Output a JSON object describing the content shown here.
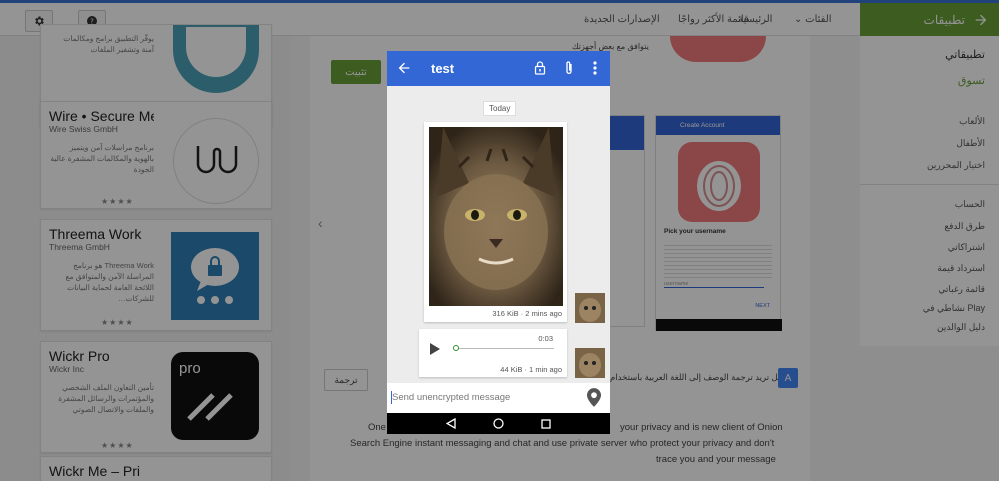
{
  "store": {
    "apps_title": "تطبيقات",
    "nav": [
      "الرئيسية",
      "قائمة الأكثر رواجًا",
      "الإصدارات الجديدة",
      "الفئات"
    ],
    "sidebar_top": [
      "تطبيقاتي",
      "تسوق"
    ],
    "sidebar_groups": [
      "الألعاب",
      "الأطفال",
      "اختيار المحررين"
    ],
    "sidebar_account": [
      "الحساب",
      "طرق الدفع",
      "اشتراكاتي",
      "استرداد قيمة",
      "قائمة رغباتي",
      "نشاطي في Play",
      "دليل الوالدين"
    ],
    "install_label": "تثبيت",
    "translate_label": "ترجمة",
    "translate_prompt": "هل تريد ترجمة الوصف إلى اللغة العربية باستخدام",
    "badge_line": "يتوافق مع بعض أجهزتك",
    "description_lines": [
      "your privacy and is new client of Onion",
      "Search Engine instant messaging and chat and use private server who protect your privacy and don't",
      "trace you and your message"
    ],
    "description_prefix": "One"
  },
  "app_cards": [
    {
      "title": "",
      "developer": "",
      "desc": "يوفّر التطبيق برامج ومكالمات آمنة وتشفير الملفات",
      "rating": "★★★★"
    },
    {
      "title": "Wire • Secure Me",
      "developer": "Wire Swiss GmbH",
      "desc": "برنامج مراسلات آمن ويتميز بالهوية والمكالمات المشفرة عالية الجودة",
      "rating": "★★★★"
    },
    {
      "title": "Threema Work",
      "developer": "Threema GmbH",
      "desc": "Threema Work هو برنامج المراسلة الآمن والمتوافق مع اللائحة العامة لحماية البيانات للشركات…",
      "rating": "★★★★"
    },
    {
      "title": "Wickr Pro",
      "developer": "Wickr Inc",
      "desc": "تأمين التعاون الملف الشخصي والمؤتمرات والرسائل المشفرة والملفات والاتصال الصوتي",
      "rating": "★★★★"
    },
    {
      "title": "Wickr Me – Pri",
      "developer": "",
      "desc": "",
      "rating": ""
    }
  ],
  "screenshot_panel": {
    "header": "Create Account",
    "heading": "Pick your username",
    "field_placeholder": "username",
    "next": "NEXT"
  },
  "chat": {
    "title": "test",
    "date_chip": "Today",
    "messages": [
      {
        "type": "image",
        "meta": "316 KiB · 2 mins ago"
      },
      {
        "type": "audio",
        "duration": "0:03",
        "meta": "44 KiB · 1 min ago",
        "progress": 0
      }
    ],
    "input_placeholder": "Send unencrypted message"
  },
  "colors": {
    "app_bar": "#3367d6",
    "store_green": "#689f38"
  }
}
